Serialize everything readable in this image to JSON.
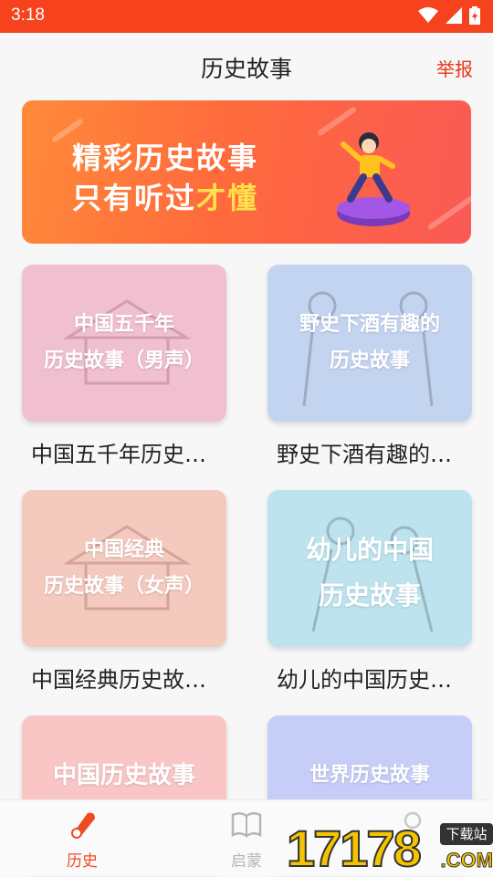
{
  "status": {
    "time": "3:18"
  },
  "header": {
    "title": "历史故事",
    "report": "举报"
  },
  "banner": {
    "line1": "精彩历史故事",
    "line2_prefix": "只有听过",
    "line2_highlight": "才懂"
  },
  "cards": [
    {
      "cover_lines": [
        "中国五千年",
        "历史故事（男声）"
      ],
      "caption": "中国五千年历史…",
      "color": "#f0bfd0"
    },
    {
      "cover_lines": [
        "野史下酒有趣的",
        "历史故事"
      ],
      "caption": "野史下酒有趣的…",
      "color": "#c3d4f1"
    },
    {
      "cover_lines": [
        "中国经典",
        "历史故事（女声）"
      ],
      "caption": "中国经典历史故…",
      "color": "#f4c9be"
    },
    {
      "cover_lines": [
        "幼儿的中国",
        "历史故事"
      ],
      "caption": "幼儿的中国历史…",
      "color": "#bde3ee"
    },
    {
      "cover_lines": [
        "中国历史故事"
      ],
      "caption": "",
      "color": "#fac5c5"
    },
    {
      "cover_lines": [
        "世界历史故事"
      ],
      "caption": "",
      "color": "#c6cdf6"
    }
  ],
  "tabs": [
    {
      "label": "历史",
      "active": true,
      "color": "#ef4a22"
    },
    {
      "label": "启蒙",
      "active": false,
      "color": "#b5b5b5"
    }
  ],
  "watermark": {
    "number": "17178",
    "badge": "下载站",
    "suffix": ".COM"
  }
}
